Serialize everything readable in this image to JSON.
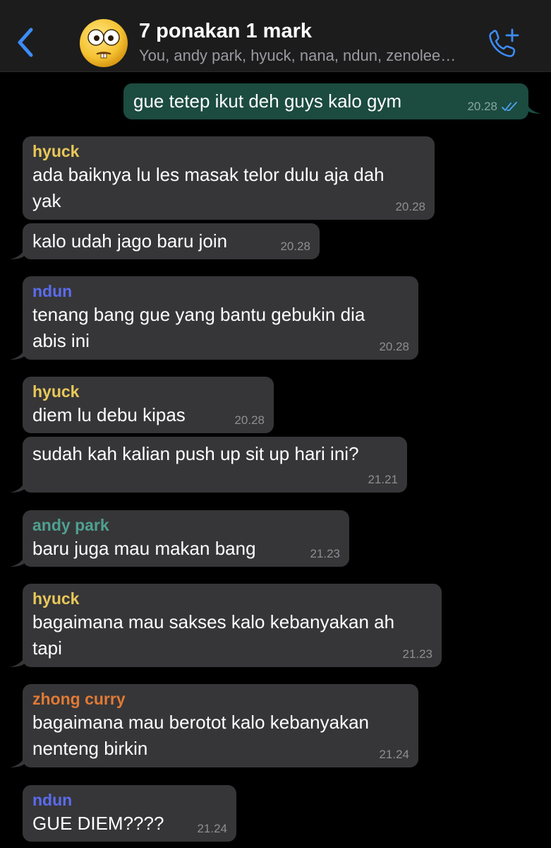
{
  "header": {
    "back_icon": "chevron-left-icon",
    "avatar_icon": "silly-face-emoji-avatar",
    "title": "7 ponakan 1 mark",
    "subtitle": "You, andy park, hyuck, nana, ndun, zenolee…",
    "call_icon": "add-call-icon",
    "accent_color": "#3d8cf5"
  },
  "colors": {
    "incoming_bubble": "#363638",
    "outgoing_bubble": "#1c4b40",
    "hyuck": "#e8c85a",
    "ndun": "#5b6cf0",
    "andy_park": "#4fa090",
    "zhong_curry": "#e07a35",
    "read_ticks": "#4fa3f7"
  },
  "messages": [
    {
      "direction": "outgoing",
      "sender": "",
      "lines": [
        "gue tetep ikut deh guys kalo gym"
      ],
      "time": "20.28",
      "status": "read"
    },
    {
      "direction": "incoming",
      "sender": "hyuck",
      "lines": [
        "ada baiknya lu les masak telor dulu aja dah",
        "yak"
      ],
      "time": "20.28"
    },
    {
      "direction": "incoming",
      "sender": "",
      "lines": [
        "kalo udah jago baru join"
      ],
      "time": "20.28"
    },
    {
      "direction": "incoming",
      "sender": "ndun",
      "lines": [
        "tenang bang gue yang bantu gebukin dia",
        "abis ini"
      ],
      "time": "20.28"
    },
    {
      "direction": "incoming",
      "sender": "hyuck",
      "lines": [
        "diem lu debu kipas"
      ],
      "time": "20.28"
    },
    {
      "direction": "incoming",
      "sender": "",
      "lines": [
        "sudah kah kalian push up sit up hari ini?"
      ],
      "time": "21.21"
    },
    {
      "direction": "incoming",
      "sender": "andy park",
      "lines": [
        "baru juga mau makan bang"
      ],
      "time": "21.23"
    },
    {
      "direction": "incoming",
      "sender": "hyuck",
      "lines": [
        "bagaimana mau sakses kalo kebanyakan ah",
        "tapi"
      ],
      "time": "21.23"
    },
    {
      "direction": "incoming",
      "sender": "zhong curry",
      "lines": [
        "bagaimana mau berotot kalo kebanyakan",
        "nenteng birkin"
      ],
      "time": "21.24"
    },
    {
      "direction": "incoming",
      "sender": "ndun",
      "lines": [
        "GUE DIEM????"
      ],
      "time": "21.24"
    }
  ]
}
